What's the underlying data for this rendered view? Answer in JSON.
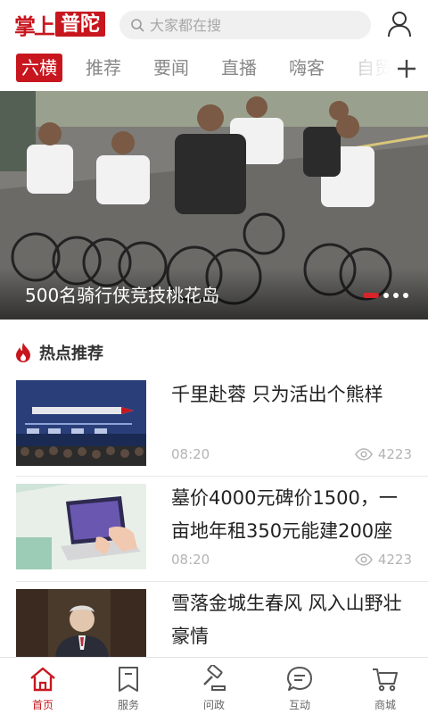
{
  "app": {
    "logo_part1": "掌上",
    "logo_part2": "普陀",
    "accent_color": "#c8161e"
  },
  "search": {
    "placeholder": "大家都在搜",
    "icon": "search-icon"
  },
  "header": {
    "user_icon": "user-icon"
  },
  "tabs": [
    {
      "label": "六横",
      "active": true
    },
    {
      "label": "推荐"
    },
    {
      "label": "要闻"
    },
    {
      "label": "直播"
    },
    {
      "label": "嗨客"
    },
    {
      "label": "自贸"
    }
  ],
  "banner": {
    "caption": "500名骑行侠竞技桃花岛",
    "slide_count": 4,
    "active_slide": 1
  },
  "section": {
    "title": "热点推荐",
    "icon": "flame-icon"
  },
  "news": [
    {
      "title": "千里赴蓉 只为活出个熊样",
      "time": "08:20",
      "views": "4223"
    },
    {
      "title": "墓价4000元碑价1500，一亩地年租350元能建200座",
      "time": "08:20",
      "views": "4223"
    },
    {
      "title": "雪落金城生春风  风入山野壮豪情"
    }
  ],
  "bottom_nav": [
    {
      "label": "首页",
      "icon": "home-icon",
      "active": true
    },
    {
      "label": "服务",
      "icon": "bookmark-icon"
    },
    {
      "label": "问政",
      "icon": "gavel-icon"
    },
    {
      "label": "互动",
      "icon": "chat-icon"
    },
    {
      "label": "商城",
      "icon": "cart-icon"
    }
  ]
}
